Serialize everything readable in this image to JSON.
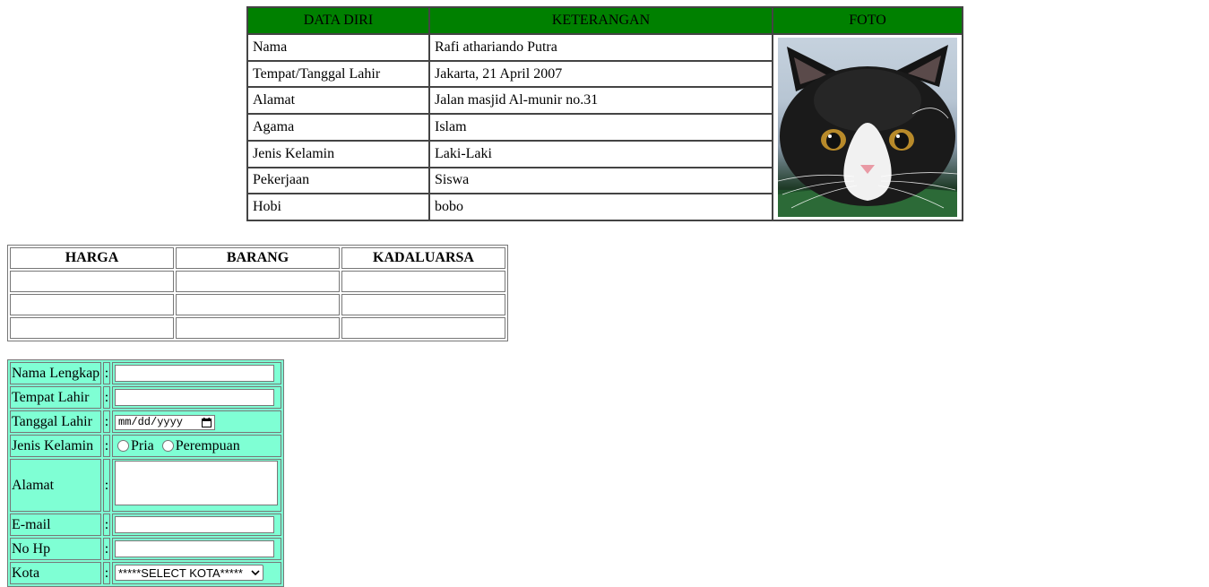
{
  "profile": {
    "headers": [
      "DATA DIRI",
      "KETERANGAN",
      "FOTO"
    ],
    "rows": [
      {
        "label": "Nama",
        "value": "Rafi athariando Putra"
      },
      {
        "label": "Tempat/Tanggal Lahir",
        "value": "Jakarta, 21 April 2007"
      },
      {
        "label": "Alamat",
        "value": "Jalan masjid Al-munir no.31"
      },
      {
        "label": "Agama",
        "value": "Islam"
      },
      {
        "label": "Jenis Kelamin",
        "value": "Laki-Laki"
      },
      {
        "label": "Pekerjaan",
        "value": "Siswa"
      },
      {
        "label": "Hobi",
        "value": "bobo"
      }
    ],
    "photo": "black-and-white cat photo",
    "header_color": "#008000"
  },
  "price_table": {
    "headers": [
      "HARGA",
      "BARANG",
      "KADALUARSA"
    ],
    "row_count": 3
  },
  "form": {
    "background_color": "#7fffd4",
    "separator": ":",
    "fields": {
      "nama": {
        "label": "Nama Lengkap",
        "value": ""
      },
      "tempat": {
        "label": "Tempat Lahir",
        "value": ""
      },
      "tanggal": {
        "label": "Tanggal Lahir",
        "placeholder": "mm/dd/yyyy",
        "icon": "calendar-icon"
      },
      "gender": {
        "label": "Jenis Kelamin",
        "options": [
          "Pria",
          "Perempuan"
        ]
      },
      "alamat": {
        "label": "Alamat",
        "value": ""
      },
      "email": {
        "label": "E-mail",
        "value": ""
      },
      "hp": {
        "label": "No Hp",
        "value": ""
      },
      "kota": {
        "label": "Kota",
        "selected": "*****SELECT KOTA*****",
        "icon": "chevron-down-icon"
      }
    }
  }
}
